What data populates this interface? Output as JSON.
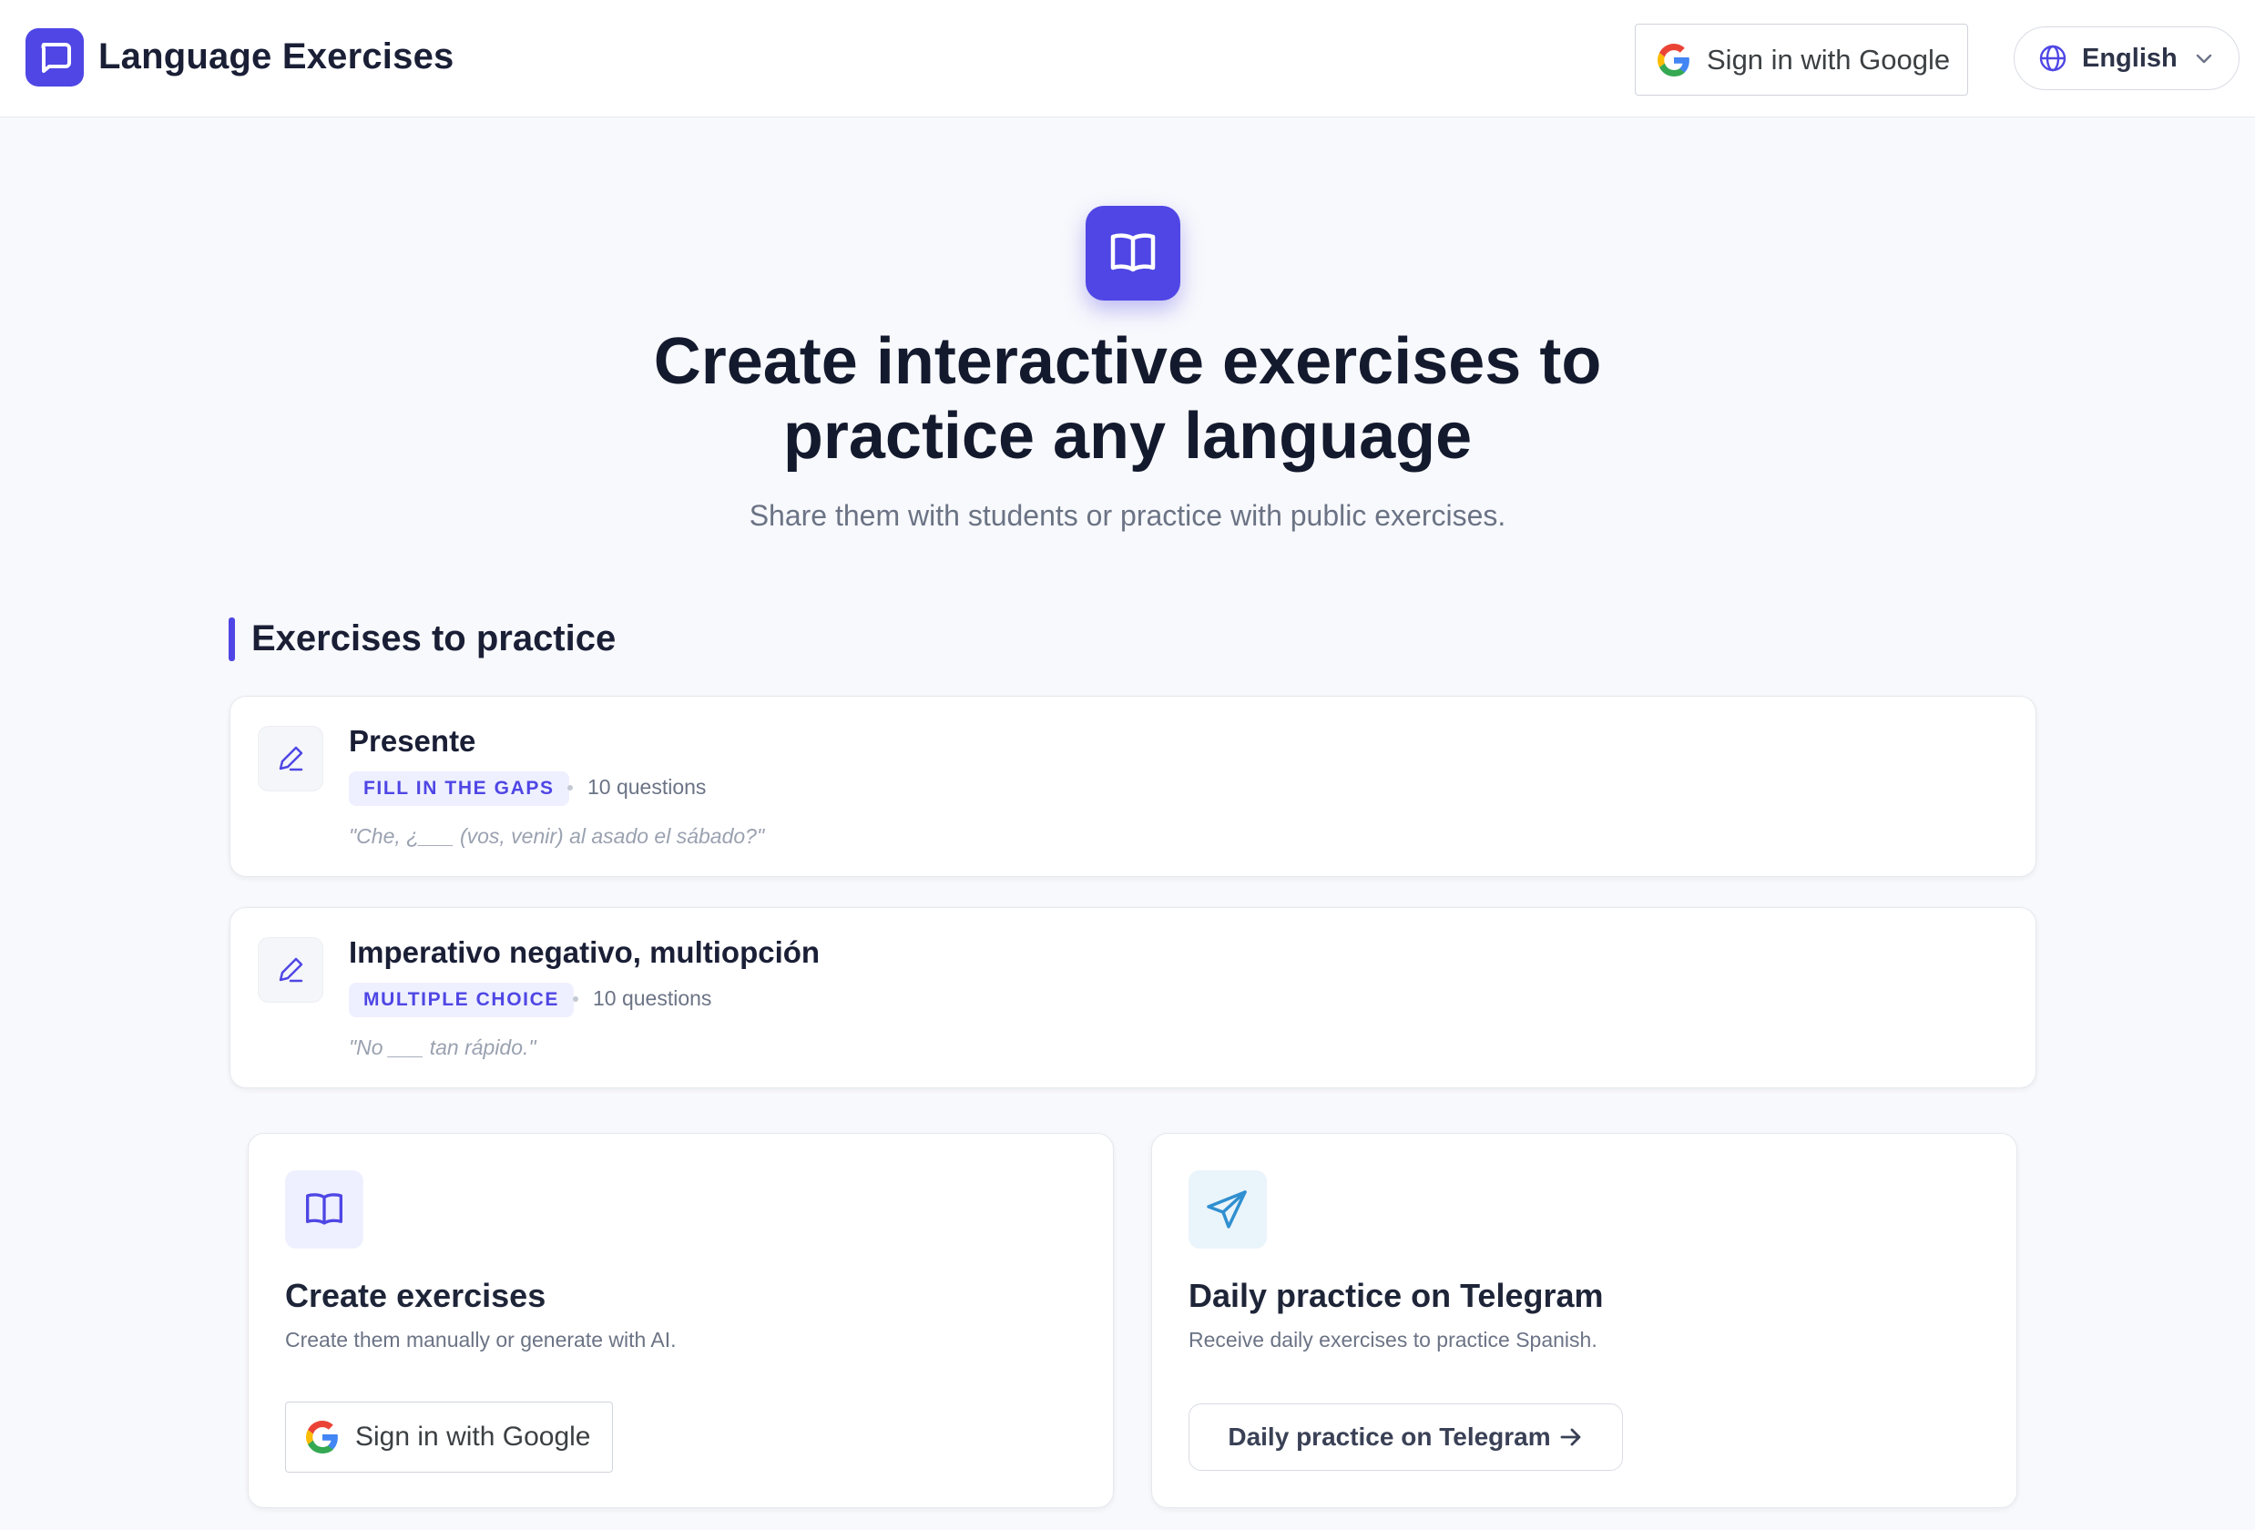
{
  "header": {
    "app_title": "Language Exercises",
    "logo_icon": "chat-bubble-icon",
    "google_signin_label": "Sign in with Google",
    "language_label": "English"
  },
  "hero": {
    "icon": "open-book-icon",
    "title_line1": "Create interactive exercises to",
    "title_line2": "practice any language",
    "subtitle": "Share them with students or practice with public exercises."
  },
  "section": {
    "title": "Exercises to practice"
  },
  "exercises": [
    {
      "title": "Presente",
      "type_badge": "FILL IN THE GAPS",
      "question_count": "10 questions",
      "example": "\"Che, ¿___ (vos, venir) al asado el sábado?\"",
      "icon": "pencil-icon"
    },
    {
      "title": "Imperativo negativo, multiopción",
      "type_badge": "MULTIPLE CHOICE",
      "question_count": "10 questions",
      "example": "\"No ___ tan rápido.\"",
      "icon": "pencil-icon"
    }
  ],
  "features": [
    {
      "icon": "open-book-icon",
      "title": "Create exercises",
      "description": "Create them manually or generate with AI.",
      "button_label": "Sign in with Google"
    },
    {
      "icon": "paper-plane-icon",
      "title": "Daily practice on Telegram",
      "description": "Receive daily exercises to practice Spanish.",
      "button_label": "Daily practice on Telegram"
    }
  ],
  "colors": {
    "accent": "#4f46e5",
    "telegram": "#2f8fd0",
    "badge_bg": "#eef0ff"
  }
}
